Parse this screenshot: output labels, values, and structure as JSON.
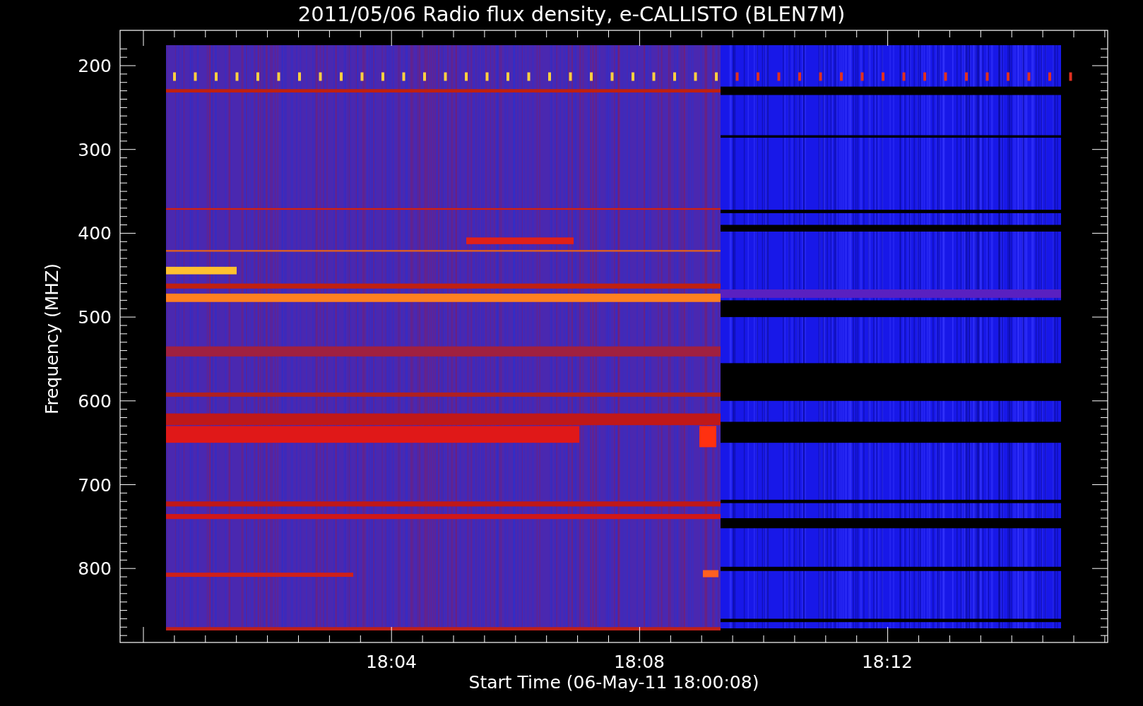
{
  "title": "2011/05/06  Radio flux density, e-CALLISTO (BLEN7M)",
  "y_axis": {
    "label": "Frequency (MHZ)",
    "ticks": [
      "200",
      "300",
      "400",
      "500",
      "600",
      "700",
      "800"
    ]
  },
  "x_axis": {
    "label": "Start Time (06-May-11 18:00:08)",
    "ticks": [
      "18:04",
      "18:08",
      "18:12"
    ]
  }
}
